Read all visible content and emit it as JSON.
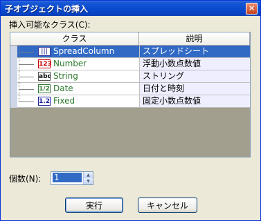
{
  "window": {
    "title": "子オブジェクトの挿入",
    "close_glyph": "✕"
  },
  "list_label": "挿入可能なクラス(C):",
  "columns": {
    "class": "クラス",
    "desc": "説明"
  },
  "rows": [
    {
      "name": "SpreadColumn",
      "desc": "スプレッドシート",
      "icon": "spreadcolumn-icon",
      "icon_text": "|||"
    },
    {
      "name": "Number",
      "desc": "浮動小数点数値",
      "icon": "number-icon",
      "icon_text": "123"
    },
    {
      "name": "String",
      "desc": "ストリング",
      "icon": "string-icon",
      "icon_text": "abc"
    },
    {
      "name": "Date",
      "desc": "日付と時刻",
      "icon": "date-icon",
      "icon_text": "1/2"
    },
    {
      "name": "Fixed",
      "desc": "固定小数点数値",
      "icon": "fixed-icon",
      "icon_text": "1.2"
    }
  ],
  "count": {
    "label": "個数(N):",
    "value": "1"
  },
  "buttons": {
    "run": "実行",
    "cancel": "キャンセル"
  },
  "colors": {
    "selection": "#316ac5",
    "titlebar": "#0a4bd0",
    "grid_empty": "#a29f8f"
  }
}
